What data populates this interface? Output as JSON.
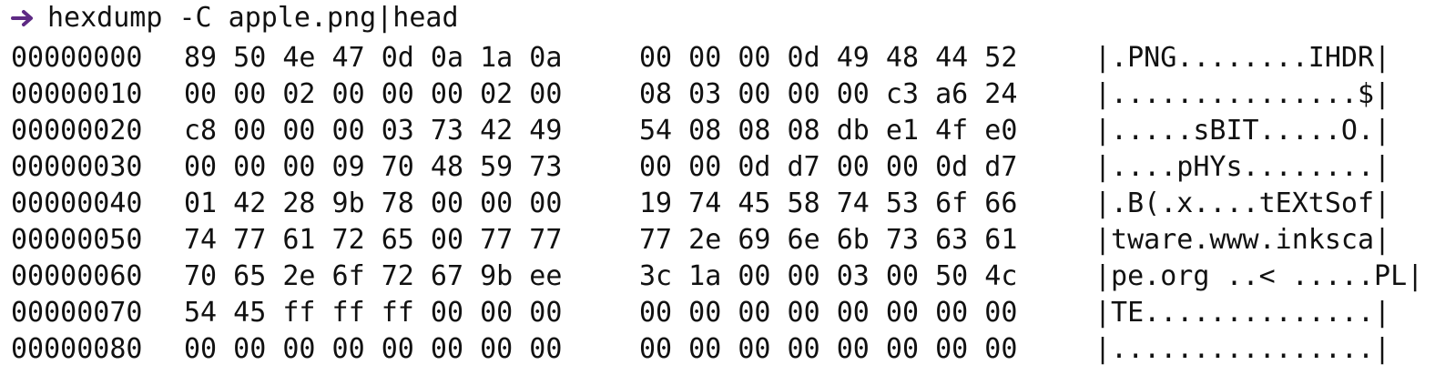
{
  "prompt": {
    "arrow_color": "#5e2a84",
    "command": "hexdump -C apple.png|head"
  },
  "rows": [
    {
      "offset": "00000000",
      "hex_a": "89 50 4e 47 0d 0a 1a 0a",
      "hex_b": "00 00 00 0d 49 48 44 52",
      "ascii": "|.PNG........IHDR|"
    },
    {
      "offset": "00000010",
      "hex_a": "00 00 02 00 00 00 02 00",
      "hex_b": "08 03 00 00 00 c3 a6 24",
      "ascii": "|...............$|"
    },
    {
      "offset": "00000020",
      "hex_a": "c8 00 00 00 03 73 42 49",
      "hex_b": "54 08 08 08 db e1 4f e0",
      "ascii": "|.....sBIT.....O.|"
    },
    {
      "offset": "00000030",
      "hex_a": "00 00 00 09 70 48 59 73",
      "hex_b": "00 00 0d d7 00 00 0d d7",
      "ascii": "|....pHYs........|"
    },
    {
      "offset": "00000040",
      "hex_a": "01 42 28 9b 78 00 00 00",
      "hex_b": "19 74 45 58 74 53 6f 66",
      "ascii": "|.B(.x....tEXtSof|"
    },
    {
      "offset": "00000050",
      "hex_a": "74 77 61 72 65 00 77 77",
      "hex_b": "77 2e 69 6e 6b 73 63 61",
      "ascii": "|tware.www.inksca|"
    },
    {
      "offset": "00000060",
      "hex_a": "70 65 2e 6f 72 67 9b ee",
      "hex_b": "3c 1a 00 00 03 00 50 4c",
      "ascii": "|pe.org ..< .....PL|"
    },
    {
      "offset": "00000070",
      "hex_a": "54 45 ff ff ff 00 00 00",
      "hex_b": "00 00 00 00 00 00 00 00",
      "ascii": "|TE..............|"
    },
    {
      "offset": "00000080",
      "hex_a": "00 00 00 00 00 00 00 00",
      "hex_b": "00 00 00 00 00 00 00 00",
      "ascii": "|................|"
    }
  ]
}
